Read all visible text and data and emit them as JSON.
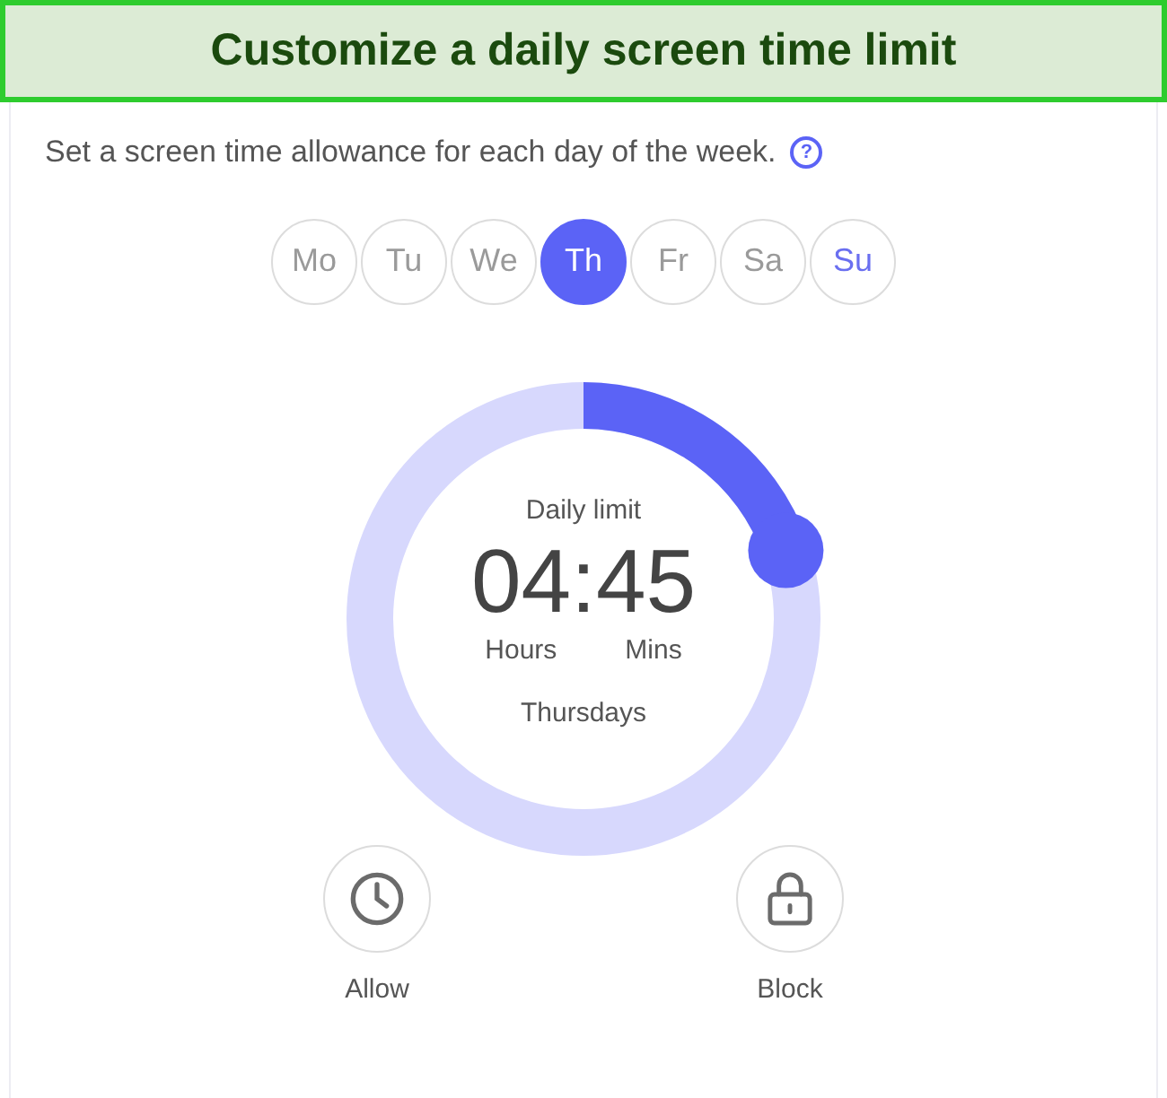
{
  "banner": {
    "title": "Customize a daily screen time limit"
  },
  "intro": {
    "text": "Set a screen time allowance for each day of the week.",
    "help": "?"
  },
  "days": [
    {
      "label": "Mo",
      "selected": false,
      "highlighted": false
    },
    {
      "label": "Tu",
      "selected": false,
      "highlighted": false
    },
    {
      "label": "We",
      "selected": false,
      "highlighted": false
    },
    {
      "label": "Th",
      "selected": true,
      "highlighted": false
    },
    {
      "label": "Fr",
      "selected": false,
      "highlighted": false
    },
    {
      "label": "Sa",
      "selected": false,
      "highlighted": false
    },
    {
      "label": "Su",
      "selected": false,
      "highlighted": true
    }
  ],
  "dial": {
    "caption": "Daily limit",
    "time": "04:45",
    "hours_label": "Hours",
    "mins_label": "Mins",
    "day": "Thursdays"
  },
  "actions": [
    {
      "kind": "allow",
      "label": "Allow"
    },
    {
      "kind": "block",
      "label": "Block"
    }
  ]
}
